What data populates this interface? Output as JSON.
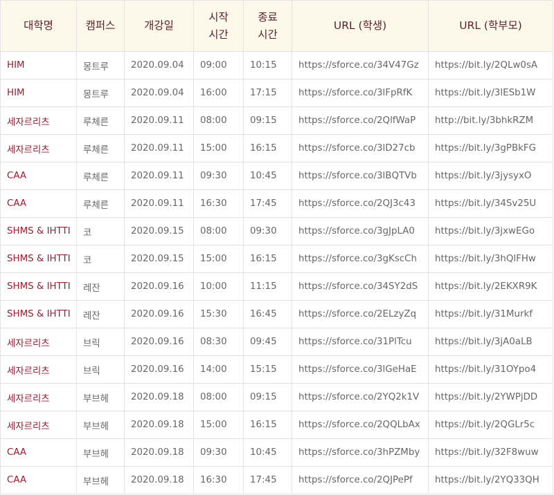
{
  "headers": {
    "university": "대학명",
    "campus": "캠퍼스",
    "open_date": "개강일",
    "start_time_1": "시작",
    "start_time_2": "시간",
    "end_time_1": "종료",
    "end_time_2": "시간",
    "url_student": "URL (학생)",
    "url_parent": "URL (학부모)"
  },
  "rows": [
    {
      "university": "HIM",
      "campus": "몽트루",
      "date": "2020.09.04",
      "start": "09:00",
      "end": "10:15",
      "url_student": "https://sforce.co/34V47Gz",
      "url_parent": "https://bit.ly/2QLw0sA"
    },
    {
      "university": "HIM",
      "campus": "몽트루",
      "date": "2020.09.04",
      "start": "16:00",
      "end": "17:15",
      "url_student": "https://sforce.co/3lFpRfK",
      "url_parent": "https://bit.ly/3lESb1W"
    },
    {
      "university": "세자르리츠",
      "campus": "루체른",
      "date": "2020.09.11",
      "start": "08:00",
      "end": "09:15",
      "url_student": "https://sforce.co/2QlfWaP",
      "url_parent": "http://bit.ly/3bhkRZM"
    },
    {
      "university": "세자르리츠",
      "campus": "루체른",
      "date": "2020.09.11",
      "start": "15:00",
      "end": "16:15",
      "url_student": "https://sforce.co/3lD27cb",
      "url_parent": "https://bit.ly/3gPBkFG"
    },
    {
      "university": "CAA",
      "campus": "루체른",
      "date": "2020.09.11",
      "start": "09:30",
      "end": "10:45",
      "url_student": "https://sforce.co/3lBQTVb",
      "url_parent": "https://bit.ly/3jysyxO"
    },
    {
      "university": "CAA",
      "campus": "루체른",
      "date": "2020.09.11",
      "start": "16:30",
      "end": "17:45",
      "url_student": "https://sforce.co/2QJ3c43",
      "url_parent": "https://bit.ly/34Sv25U"
    },
    {
      "university": "SHMS & IHTTI",
      "campus": "코",
      "date": "2020.09.15",
      "start": "08:00",
      "end": "09:30",
      "url_student": "https://sforce.co/3gJpLA0",
      "url_parent": "https://bit.ly/3jxwEGo"
    },
    {
      "university": "SHMS & IHTTI",
      "campus": "코",
      "date": "2020.09.15",
      "start": "15:00",
      "end": "16:15",
      "url_student": "https://sforce.co/3gKscCh",
      "url_parent": "https://bit.ly/3hQlFHw"
    },
    {
      "university": "SHMS & IHTTI",
      "campus": "레잔",
      "date": "2020.09.16",
      "start": "10:00",
      "end": "11:15",
      "url_student": "https://sforce.co/34SY2dS",
      "url_parent": "https://bit.ly/2EKXR9K"
    },
    {
      "university": "SHMS & IHTTI",
      "campus": "레잔",
      "date": "2020.09.16",
      "start": "15:30",
      "end": "16:45",
      "url_student": "https://sforce.co/2ELzyZq",
      "url_parent": "https://bit.ly/31Murkf"
    },
    {
      "university": "세자르리츠",
      "campus": "브릭",
      "date": "2020.09.16",
      "start": "08:30",
      "end": "09:45",
      "url_student": "https://sforce.co/31PlTcu",
      "url_parent": "https://bit.ly/3jA0aLB"
    },
    {
      "university": "세자르리츠",
      "campus": "브릭",
      "date": "2020.09.16",
      "start": "14:00",
      "end": "15:15",
      "url_student": "https://sforce.co/3lGeHaE",
      "url_parent": "https://bit.ly/31OYpo4"
    },
    {
      "university": "세자르리츠",
      "campus": "부브헤",
      "date": "2020.09.18",
      "start": "08:00",
      "end": "09:15",
      "url_student": "https://sforce.co/2YQ2k1V",
      "url_parent": "https://bit.ly/2YWPjDD"
    },
    {
      "university": "세자르리츠",
      "campus": "부브헤",
      "date": "2020.09.18",
      "start": "15:00",
      "end": "16:15",
      "url_student": "https://sforce.co/2QQLbAx",
      "url_parent": "https://bit.ly/2QGLr5c"
    },
    {
      "university": "CAA",
      "campus": "부브헤",
      "date": "2020.09.18",
      "start": "09:30",
      "end": "10:45",
      "url_student": "https://sforce.co/3hPZMby",
      "url_parent": "https://bit.ly/32F8wuw"
    },
    {
      "university": "CAA",
      "campus": "부브헤",
      "date": "2020.09.18",
      "start": "16:30",
      "end": "17:45",
      "url_student": "https://sforce.co/2QJPePf",
      "url_parent": "https://bit.ly/2YQ33QH"
    }
  ],
  "colors": {
    "header_bg": "#fdf9ea",
    "header_text": "#5b1f2c",
    "university_text": "#9b1b30",
    "cell_text": "#666666",
    "border": "#e3e3e3"
  }
}
